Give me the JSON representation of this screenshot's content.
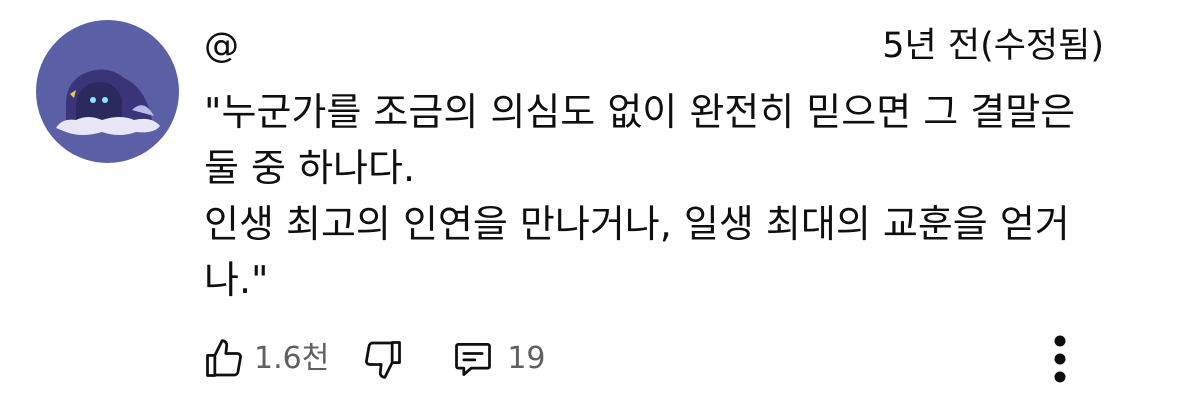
{
  "comment": {
    "author": "@",
    "timestamp": "5년 전(수정됨)",
    "lines": [
      "\"누군가를 조금의 의심도 없이 완전히 믿으면 그 결말은",
      "둘 중 하나다.",
      "인생 최고의 인연을 만나거나, 일생 최대의 교훈을 얻거",
      "나.\""
    ]
  },
  "actions": {
    "like_count": "1.6천",
    "reply_count": "19"
  },
  "icons": {
    "like": "thumbs-up-icon",
    "dislike": "thumbs-down-icon",
    "reply": "comment-icon",
    "more": "more-vertical-icon"
  },
  "colors": {
    "text": "#0f0f0f",
    "secondary_text": "#606060",
    "avatar_bg": "#5a5fa6"
  }
}
